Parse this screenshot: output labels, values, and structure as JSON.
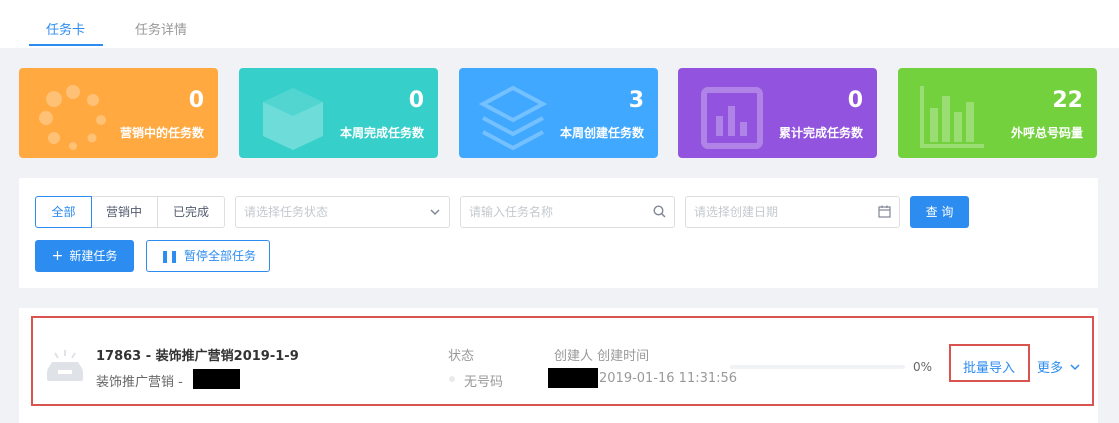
{
  "tabs": [
    {
      "label": "任务卡",
      "active": true
    },
    {
      "label": "任务详情",
      "active": false
    }
  ],
  "stats": [
    {
      "value": "0",
      "label": "营销中的任务数",
      "color": "#ffa940",
      "icon": "spinner-icon"
    },
    {
      "value": "0",
      "label": "本周完成任务数",
      "color": "#36cfc9",
      "icon": "box-icon"
    },
    {
      "value": "3",
      "label": "本周创建任务数",
      "color": "#40a9ff",
      "icon": "layers-icon"
    },
    {
      "value": "0",
      "label": "累计完成任务数",
      "color": "#9254de",
      "icon": "report-icon"
    },
    {
      "value": "22",
      "label": "外呼总号码量",
      "color": "#73d13d",
      "icon": "bar-chart-icon"
    }
  ],
  "filter": {
    "segments": [
      {
        "label": "全部",
        "active": true
      },
      {
        "label": "营销中",
        "active": false
      },
      {
        "label": "已完成",
        "active": false
      }
    ],
    "status_placeholder": "请选择任务状态",
    "name_placeholder": "请输入任务名称",
    "date_placeholder": "请选择创建日期",
    "query_label": "查 询",
    "new_task_label": "新建任务",
    "pause_all_label": "暂停全部任务"
  },
  "task": {
    "title": "17863 - 装饰推广营销2019-1-9",
    "subtitle": "装饰推广营销 -",
    "status_header": "状态",
    "status_value": "无号码",
    "creator_header": "创建人 创建时间",
    "created_time": "2019-01-16 11:31:56",
    "progress_text": "0%",
    "progress": 0,
    "import_label": "批量导入",
    "more_label": "更多"
  },
  "colors": {
    "accent": "#2d8cf0",
    "highlight": "#d9534f"
  }
}
